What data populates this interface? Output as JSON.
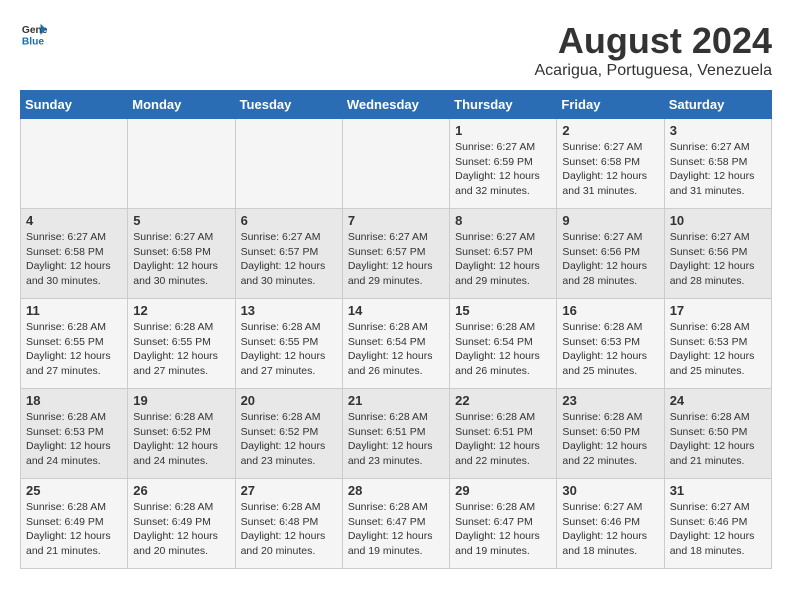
{
  "header": {
    "logo_general": "General",
    "logo_blue": "Blue",
    "title": "August 2024",
    "subtitle": "Acarigua, Portuguesa, Venezuela"
  },
  "days_of_week": [
    "Sunday",
    "Monday",
    "Tuesday",
    "Wednesday",
    "Thursday",
    "Friday",
    "Saturday"
  ],
  "weeks": [
    [
      {
        "day": "",
        "content": ""
      },
      {
        "day": "",
        "content": ""
      },
      {
        "day": "",
        "content": ""
      },
      {
        "day": "",
        "content": ""
      },
      {
        "day": "1",
        "content": "Sunrise: 6:27 AM\nSunset: 6:59 PM\nDaylight: 12 hours\nand 32 minutes."
      },
      {
        "day": "2",
        "content": "Sunrise: 6:27 AM\nSunset: 6:58 PM\nDaylight: 12 hours\nand 31 minutes."
      },
      {
        "day": "3",
        "content": "Sunrise: 6:27 AM\nSunset: 6:58 PM\nDaylight: 12 hours\nand 31 minutes."
      }
    ],
    [
      {
        "day": "4",
        "content": "Sunrise: 6:27 AM\nSunset: 6:58 PM\nDaylight: 12 hours\nand 30 minutes."
      },
      {
        "day": "5",
        "content": "Sunrise: 6:27 AM\nSunset: 6:58 PM\nDaylight: 12 hours\nand 30 minutes."
      },
      {
        "day": "6",
        "content": "Sunrise: 6:27 AM\nSunset: 6:57 PM\nDaylight: 12 hours\nand 30 minutes."
      },
      {
        "day": "7",
        "content": "Sunrise: 6:27 AM\nSunset: 6:57 PM\nDaylight: 12 hours\nand 29 minutes."
      },
      {
        "day": "8",
        "content": "Sunrise: 6:27 AM\nSunset: 6:57 PM\nDaylight: 12 hours\nand 29 minutes."
      },
      {
        "day": "9",
        "content": "Sunrise: 6:27 AM\nSunset: 6:56 PM\nDaylight: 12 hours\nand 28 minutes."
      },
      {
        "day": "10",
        "content": "Sunrise: 6:27 AM\nSunset: 6:56 PM\nDaylight: 12 hours\nand 28 minutes."
      }
    ],
    [
      {
        "day": "11",
        "content": "Sunrise: 6:28 AM\nSunset: 6:55 PM\nDaylight: 12 hours\nand 27 minutes."
      },
      {
        "day": "12",
        "content": "Sunrise: 6:28 AM\nSunset: 6:55 PM\nDaylight: 12 hours\nand 27 minutes."
      },
      {
        "day": "13",
        "content": "Sunrise: 6:28 AM\nSunset: 6:55 PM\nDaylight: 12 hours\nand 27 minutes."
      },
      {
        "day": "14",
        "content": "Sunrise: 6:28 AM\nSunset: 6:54 PM\nDaylight: 12 hours\nand 26 minutes."
      },
      {
        "day": "15",
        "content": "Sunrise: 6:28 AM\nSunset: 6:54 PM\nDaylight: 12 hours\nand 26 minutes."
      },
      {
        "day": "16",
        "content": "Sunrise: 6:28 AM\nSunset: 6:53 PM\nDaylight: 12 hours\nand 25 minutes."
      },
      {
        "day": "17",
        "content": "Sunrise: 6:28 AM\nSunset: 6:53 PM\nDaylight: 12 hours\nand 25 minutes."
      }
    ],
    [
      {
        "day": "18",
        "content": "Sunrise: 6:28 AM\nSunset: 6:53 PM\nDaylight: 12 hours\nand 24 minutes."
      },
      {
        "day": "19",
        "content": "Sunrise: 6:28 AM\nSunset: 6:52 PM\nDaylight: 12 hours\nand 24 minutes."
      },
      {
        "day": "20",
        "content": "Sunrise: 6:28 AM\nSunset: 6:52 PM\nDaylight: 12 hours\nand 23 minutes."
      },
      {
        "day": "21",
        "content": "Sunrise: 6:28 AM\nSunset: 6:51 PM\nDaylight: 12 hours\nand 23 minutes."
      },
      {
        "day": "22",
        "content": "Sunrise: 6:28 AM\nSunset: 6:51 PM\nDaylight: 12 hours\nand 22 minutes."
      },
      {
        "day": "23",
        "content": "Sunrise: 6:28 AM\nSunset: 6:50 PM\nDaylight: 12 hours\nand 22 minutes."
      },
      {
        "day": "24",
        "content": "Sunrise: 6:28 AM\nSunset: 6:50 PM\nDaylight: 12 hours\nand 21 minutes."
      }
    ],
    [
      {
        "day": "25",
        "content": "Sunrise: 6:28 AM\nSunset: 6:49 PM\nDaylight: 12 hours\nand 21 minutes."
      },
      {
        "day": "26",
        "content": "Sunrise: 6:28 AM\nSunset: 6:49 PM\nDaylight: 12 hours\nand 20 minutes."
      },
      {
        "day": "27",
        "content": "Sunrise: 6:28 AM\nSunset: 6:48 PM\nDaylight: 12 hours\nand 20 minutes."
      },
      {
        "day": "28",
        "content": "Sunrise: 6:28 AM\nSunset: 6:47 PM\nDaylight: 12 hours\nand 19 minutes."
      },
      {
        "day": "29",
        "content": "Sunrise: 6:28 AM\nSunset: 6:47 PM\nDaylight: 12 hours\nand 19 minutes."
      },
      {
        "day": "30",
        "content": "Sunrise: 6:27 AM\nSunset: 6:46 PM\nDaylight: 12 hours\nand 18 minutes."
      },
      {
        "day": "31",
        "content": "Sunrise: 6:27 AM\nSunset: 6:46 PM\nDaylight: 12 hours\nand 18 minutes."
      }
    ]
  ]
}
